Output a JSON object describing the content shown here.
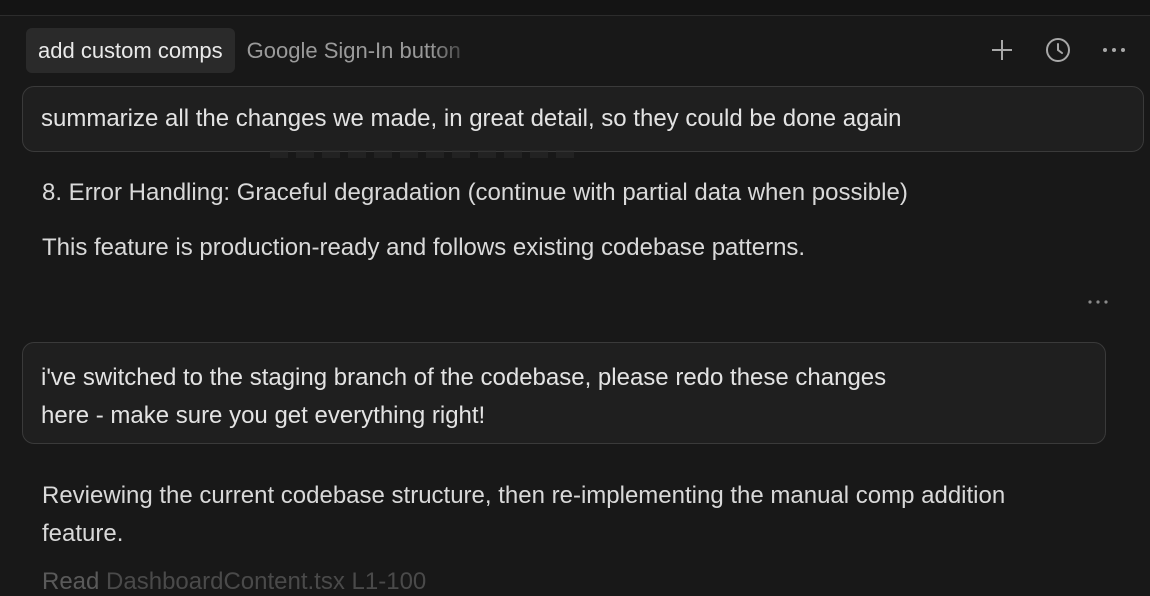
{
  "tabs": [
    {
      "label": "add custom comps",
      "active": true
    },
    {
      "label": "Google Sign-In button",
      "active": false
    }
  ],
  "actions": {
    "new_icon": "plus-icon",
    "history_icon": "clock-icon",
    "more_icon": "ellipsis-icon"
  },
  "messages": {
    "user1": "summarize all the changes we made, in great detail, so they could be done again",
    "assistant1_item": "8. Error Handling: Graceful degradation (continue with partial data when possible)",
    "assistant1_summary": "This feature is production-ready and follows existing codebase patterns.",
    "user2_line1": "i've switched to the staging branch of the codebase, please redo these changes",
    "user2_line2": "here - make sure you get everything right!",
    "assistant2": "Reviewing the current codebase structure, then re-implementing the manual comp addition feature.",
    "tool_read_label": "Read",
    "tool_read_file": "DashboardContent.tsx",
    "tool_read_range": "L1-100"
  },
  "colors": {
    "background": "#181818",
    "bubble_bg": "#1f1f1f",
    "bubble_border": "#3a3a3a",
    "tab_active_bg": "#2a2a2a"
  }
}
